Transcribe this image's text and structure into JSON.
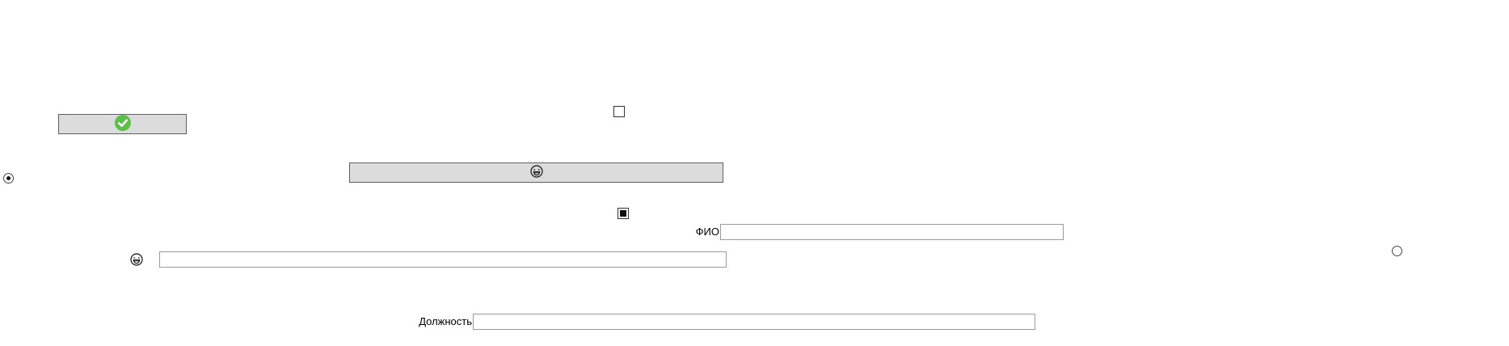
{
  "form": {
    "confirm_button": {
      "icon": "check-circle-icon",
      "icon_color": "#5cbf4a"
    },
    "emoji_button": {
      "icon": "laughing-face-icon"
    },
    "checkbox_top": {
      "checked": false
    },
    "checkbox_middle": {
      "checked": true
    },
    "radio_left": {
      "checked": true
    },
    "radio_right": {
      "checked": false
    },
    "fio": {
      "label": "ФИО",
      "value": "",
      "placeholder": ""
    },
    "emoji_field": {
      "icons": [
        "laughing-face-icon",
        "grinning-face-icon"
      ],
      "value": "",
      "placeholder": ""
    },
    "position": {
      "label": "Должность",
      "value": "",
      "placeholder": ""
    }
  },
  "colors": {
    "button_bg": "#dcdcdc",
    "button_border": "#5f5f5f",
    "field_border": "#9a9a9a",
    "accent_green": "#5cbf4a"
  }
}
